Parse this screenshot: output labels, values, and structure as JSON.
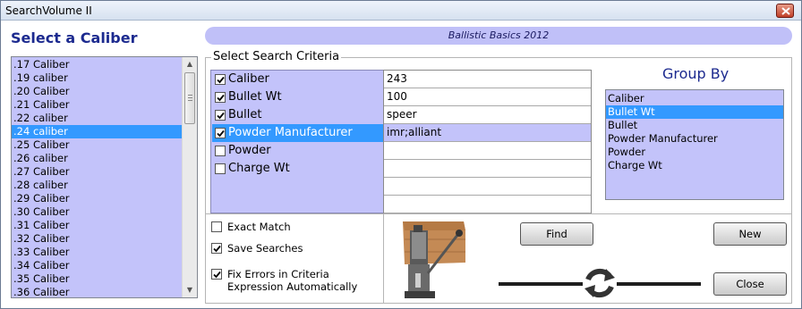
{
  "window": {
    "title": "SearchVolume II"
  },
  "caliber_panel": {
    "heading": "Select a Caliber",
    "items": [
      ".17 Caliber",
      ".19 caliber",
      ".20 Caliber",
      ".21 Caliber",
      ".22 caliber",
      ".24 caliber",
      ".25 Caliber",
      ".26 caliber",
      ".27 Caliber",
      ".28 caliber",
      ".29 Caliber",
      ".30 Caliber",
      ".31 Caliber",
      ".32 Caliber",
      ".33 Caliber",
      ".34 Caliber",
      ".35 Caliber",
      ".36 Caliber"
    ],
    "selected_item": ".24 caliber"
  },
  "banner": {
    "text": "Ballistic Basics 2012"
  },
  "criteria": {
    "legend": "Select Search Criteria",
    "rows": [
      {
        "label": "Caliber",
        "checked": true,
        "value": "243"
      },
      {
        "label": "Bullet Wt",
        "checked": true,
        "value": "100"
      },
      {
        "label": "Bullet",
        "checked": true,
        "value": "speer"
      },
      {
        "label": "Powder Manufacturer",
        "checked": true,
        "value": "imr;alliant",
        "selected": true
      },
      {
        "label": "Powder",
        "checked": false,
        "value": ""
      },
      {
        "label": "Charge Wt",
        "checked": false,
        "value": ""
      },
      {
        "label": "",
        "checked": false,
        "value": ""
      },
      {
        "label": "",
        "checked": false,
        "value": ""
      }
    ]
  },
  "group_by": {
    "heading": "Group By",
    "items": [
      "Caliber",
      "Bullet Wt",
      "Bullet",
      "Powder Manufacturer",
      "Powder",
      "Charge Wt"
    ],
    "selected_item": "Bullet Wt"
  },
  "options": {
    "exact_match": {
      "label": "Exact Match",
      "checked": false
    },
    "save_searches": {
      "label": "Save Searches",
      "checked": true
    },
    "fix_errors": {
      "label_line1": "Fix Errors in Criteria",
      "label_line2": "Expression Automatically",
      "checked": true
    }
  },
  "buttons": {
    "find": "Find",
    "new": "New",
    "close": "Close"
  },
  "colors": {
    "list_bg": "#c3c3fa",
    "selection": "#3399ff",
    "heading": "#1c2a8f",
    "banner_bg": "#c0c0f8"
  }
}
